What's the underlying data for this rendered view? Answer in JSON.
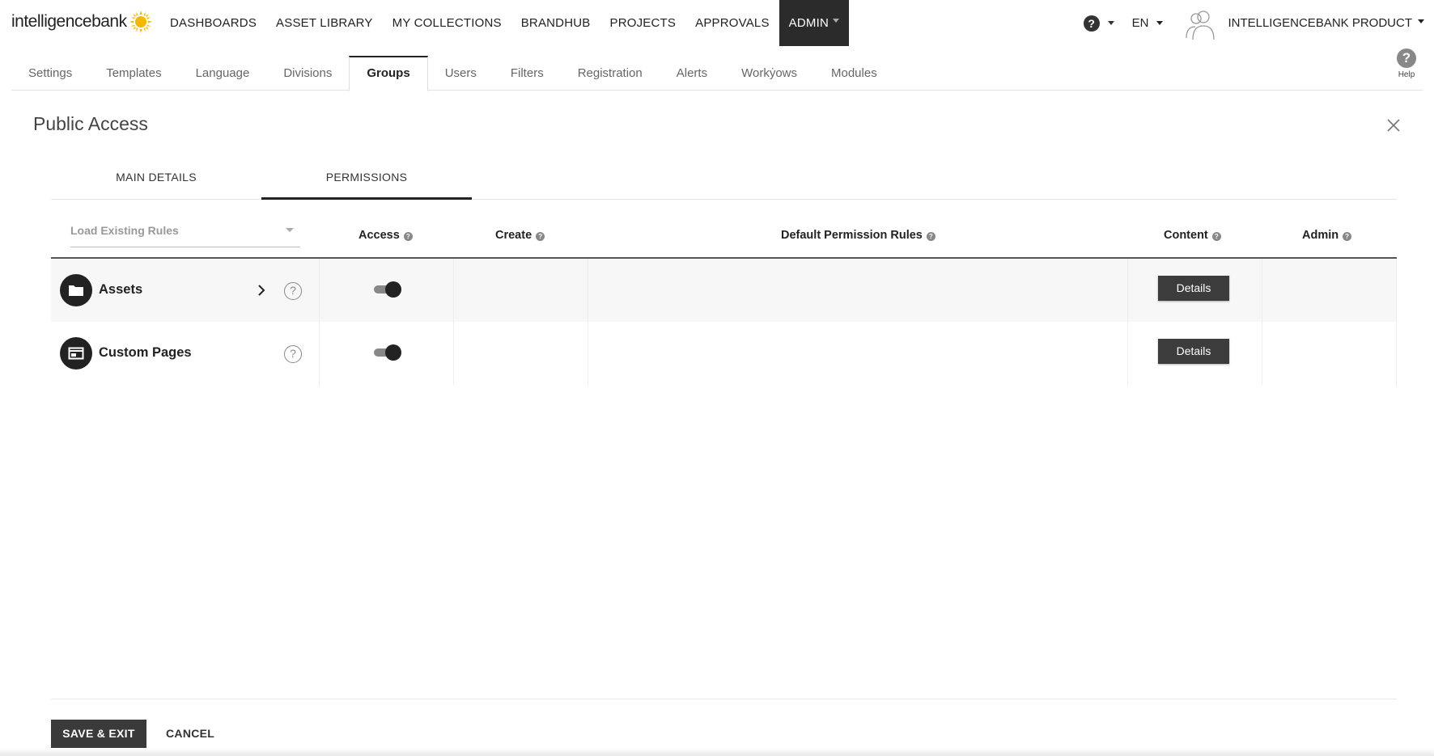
{
  "app": {
    "logo_text": "intelligencebank",
    "logo_icon": "sun-logo-icon",
    "brand_accent": "#f5b800"
  },
  "topnav": {
    "items": [
      {
        "label": "DASHBOARDS"
      },
      {
        "label": "ASSET LIBRARY"
      },
      {
        "label": "MY COLLECTIONS"
      },
      {
        "label": "BRANDHUB"
      },
      {
        "label": "PROJECTS"
      },
      {
        "label": "APPROVALS"
      },
      {
        "label": "ADMIN",
        "active": true
      }
    ],
    "help_icon": "?",
    "language": "EN",
    "account_name": "INTELLIGENCEBANK PRODUCT"
  },
  "subnav": {
    "items": [
      {
        "label": "Settings"
      },
      {
        "label": "Templates"
      },
      {
        "label": "Language"
      },
      {
        "label": "Divisions"
      },
      {
        "label": "Groups",
        "active": true
      },
      {
        "label": "Users"
      },
      {
        "label": "Filters"
      },
      {
        "label": "Registration"
      },
      {
        "label": "Alerts"
      },
      {
        "label": "Workẏows"
      },
      {
        "label": "Modules"
      }
    ],
    "help_label": "Help",
    "help_icon": "?"
  },
  "panel": {
    "title": "Public Access",
    "tabs": [
      {
        "label": "MAIN DETAILS"
      },
      {
        "label": "PERMISSIONS",
        "active": true
      }
    ]
  },
  "permissions": {
    "load_placeholder": "Load Existing Rules",
    "columns": {
      "access": "Access",
      "create": "Create",
      "default_rules": "Default Permission Rules",
      "content": "Content",
      "admin": "Admin"
    },
    "help_mark": "?",
    "rows": [
      {
        "label": "Assets",
        "icon": "folder-icon",
        "access": true,
        "details_label": "Details",
        "help_mark": "?"
      },
      {
        "label": "Custom Pages",
        "icon": "page-icon",
        "access": true,
        "details_label": "Details",
        "help_mark": "?"
      }
    ]
  },
  "footer": {
    "save_label": "SAVE & EXIT",
    "cancel_label": "CANCEL"
  },
  "colors": {
    "dark": "#2b2b2b",
    "button": "#3c3c3c",
    "muted": "#888888"
  }
}
